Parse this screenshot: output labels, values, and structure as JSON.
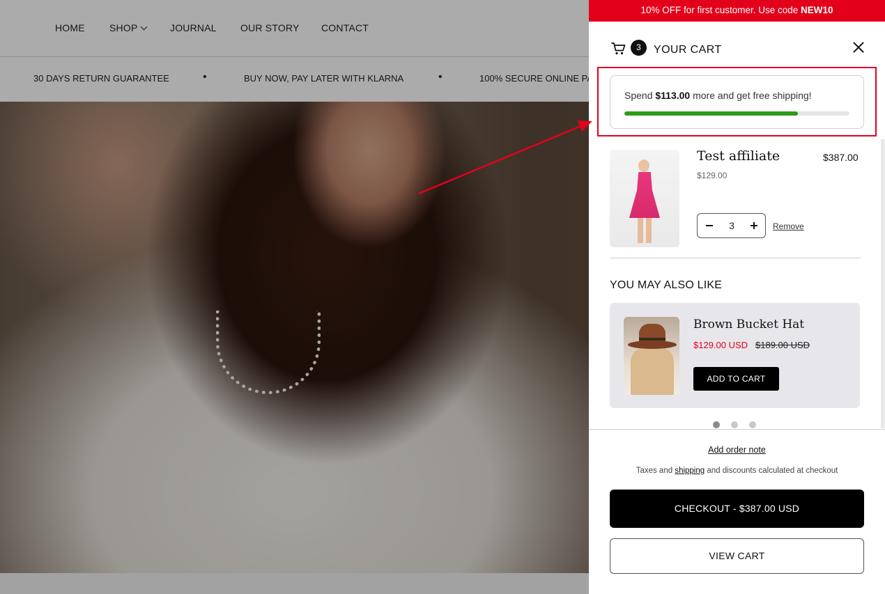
{
  "nav": {
    "items": [
      "HOME",
      "SHOP",
      "JOURNAL",
      "OUR STORY",
      "CONTACT"
    ]
  },
  "usp": {
    "items": [
      "30 DAYS RETURN GUARANTEE",
      "BUY NOW, PAY LATER WITH KLARNA",
      "100% SECURE ONLINE PA"
    ],
    "separator": "•"
  },
  "promo_bar": {
    "text": "10% OFF for first customer. Use code ",
    "code": "NEW10"
  },
  "cart": {
    "title": "YOUR CART",
    "count": "3",
    "icons": {
      "cart": "shopping-cart-icon",
      "close": "close-icon"
    }
  },
  "shipping": {
    "prefix": "Spend ",
    "amount": "$113.00",
    "suffix": " more and get free shipping!",
    "progress": 0.77,
    "color": "#2e9a1a"
  },
  "line_item": {
    "name": "Test affiliate",
    "unit_price": "$129.00",
    "total": "$387.00",
    "quantity": "3",
    "remove_label": "Remove"
  },
  "recommendations": {
    "title": "YOU MAY ALSO LIKE",
    "product": {
      "name": "Brown Bucket Hat",
      "sale_price": "$129.00 USD",
      "compare_price": "$189.00 USD",
      "button": "ADD TO CART"
    },
    "pages": 3,
    "active_page": 1
  },
  "footer": {
    "order_note": "Add order note",
    "taxes_prefix": "Taxes and ",
    "taxes_link": "shipping",
    "taxes_suffix": " and discounts calculated at checkout",
    "checkout": "CHECKOUT - $387.00 USD",
    "view_cart": "VIEW CART"
  },
  "colors": {
    "accent_red": "#e3001b",
    "progress_green": "#2e9a1a",
    "card_bg": "#e7e7eb"
  }
}
